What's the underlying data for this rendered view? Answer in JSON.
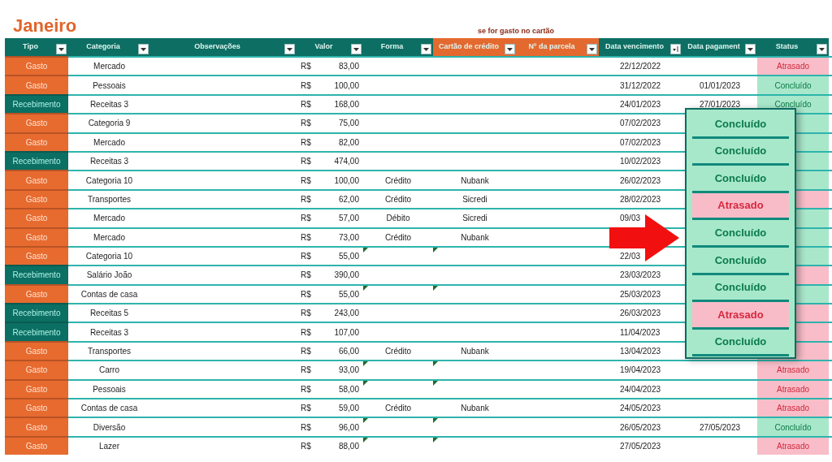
{
  "title": "Janeiro",
  "note": "se for gasto no cartão",
  "columns": [
    {
      "label": "Tipo",
      "kind": "main",
      "sorted": false
    },
    {
      "label": "Categoria",
      "kind": "main",
      "sorted": false
    },
    {
      "label": "Observações",
      "kind": "main",
      "sorted": false
    },
    {
      "label": "Valor",
      "kind": "main",
      "sorted": false
    },
    {
      "label": "Forma",
      "kind": "main",
      "sorted": false
    },
    {
      "label": "Cartão de crédito",
      "kind": "card",
      "sorted": false
    },
    {
      "label": "Nº da parcela",
      "kind": "card",
      "sorted": false
    },
    {
      "label": "Data vencimento",
      "kind": "main",
      "sorted": true
    },
    {
      "label": "Data pagament",
      "kind": "main",
      "sorted": false
    },
    {
      "label": "Status",
      "kind": "main",
      "sorted": false
    }
  ],
  "rows": [
    {
      "tipo": "Gasto",
      "kind": "gasto",
      "categoria": "Mercado",
      "currency": "R$",
      "valor": "83,00",
      "vencimento": "22/12/2022",
      "status": "Atrasado",
      "overdue": true,
      "flag": false
    },
    {
      "tipo": "Gasto",
      "kind": "gasto",
      "categoria": "Pessoais",
      "currency": "R$",
      "valor": "100,00",
      "vencimento": "31/12/2022",
      "pagamento": "01/01/2023",
      "status": "Concluído",
      "overdue": false,
      "flag": false
    },
    {
      "tipo": "Recebimento",
      "kind": "recebimento",
      "categoria": "Receitas 3",
      "currency": "R$",
      "valor": "168,00",
      "vencimento": "24/01/2023",
      "pagamento": "27/01/2023",
      "status": "Concluído",
      "overdue": false,
      "flag": false
    },
    {
      "tipo": "Gasto",
      "kind": "gasto",
      "categoria": "Categoria 9",
      "currency": "R$",
      "valor": "75,00",
      "vencimento": "07/02/2023",
      "overdue": false,
      "flag": false
    },
    {
      "tipo": "Gasto",
      "kind": "gasto",
      "categoria": "Mercado",
      "currency": "R$",
      "valor": "82,00",
      "vencimento": "07/02/2023",
      "overdue": false,
      "flag": false
    },
    {
      "tipo": "Recebimento",
      "kind": "recebimento",
      "categoria": "Receitas 3",
      "currency": "R$",
      "valor": "474,00",
      "vencimento": "10/02/2023",
      "overdue": false,
      "flag": false
    },
    {
      "tipo": "Gasto",
      "kind": "gasto",
      "categoria": "Categoria 10",
      "currency": "R$",
      "valor": "100,00",
      "forma": "Crédito",
      "cartao": "Nubank",
      "vencimento": "26/02/2023",
      "overdue": false,
      "flag": false
    },
    {
      "tipo": "Gasto",
      "kind": "gasto",
      "categoria": "Transportes",
      "currency": "R$",
      "valor": "62,00",
      "forma": "Crédito",
      "cartao": "Sicredi",
      "vencimento": "28/02/2023",
      "overdue": true,
      "flag": false
    },
    {
      "tipo": "Gasto",
      "kind": "gasto",
      "categoria": "Mercado",
      "currency": "R$",
      "valor": "57,00",
      "forma": "Débito",
      "cartao": "Sicredi",
      "vencimento": "09/03",
      "overdue": false,
      "flag": false
    },
    {
      "tipo": "Gasto",
      "kind": "gasto",
      "categoria": "Mercado",
      "currency": "R$",
      "valor": "73,00",
      "forma": "Crédito",
      "cartao": "Nubank",
      "overdue": false,
      "flag": false
    },
    {
      "tipo": "Gasto",
      "kind": "gasto",
      "categoria": "Categoria 10",
      "currency": "R$",
      "valor": "55,00",
      "vencimento": "22/03",
      "overdue": false,
      "flag": true
    },
    {
      "tipo": "Recebimento",
      "kind": "recebimento",
      "categoria": "Salário João",
      "currency": "R$",
      "valor": "390,00",
      "vencimento": "23/03/2023",
      "overdue": true,
      "flag": false
    },
    {
      "tipo": "Gasto",
      "kind": "gasto",
      "categoria": "Contas de casa",
      "currency": "R$",
      "valor": "55,00",
      "vencimento": "25/03/2023",
      "overdue": false,
      "flag": true
    },
    {
      "tipo": "Recebimento",
      "kind": "recebimento",
      "categoria": "Receitas 5",
      "currency": "R$",
      "valor": "243,00",
      "vencimento": "26/03/2023",
      "overdue": true,
      "flag": false
    },
    {
      "tipo": "Recebimento",
      "kind": "recebimento",
      "categoria": "Receitas 3",
      "currency": "R$",
      "valor": "107,00",
      "vencimento": "11/04/2023",
      "overdue": true,
      "flag": false
    },
    {
      "tipo": "Gasto",
      "kind": "gasto",
      "categoria": "Transportes",
      "currency": "R$",
      "valor": "66,00",
      "forma": "Crédito",
      "cartao": "Nubank",
      "vencimento": "13/04/2023",
      "overdue": true,
      "flag": false
    },
    {
      "tipo": "Gasto",
      "kind": "gasto",
      "categoria": "Carro",
      "currency": "R$",
      "valor": "93,00",
      "vencimento": "19/04/2023",
      "status": "Atrasado",
      "overdue": true,
      "flag": true
    },
    {
      "tipo": "Gasto",
      "kind": "gasto",
      "categoria": "Pessoais",
      "currency": "R$",
      "valor": "58,00",
      "vencimento": "24/04/2023",
      "status": "Atrasado",
      "overdue": true,
      "flag": true
    },
    {
      "tipo": "Gasto",
      "kind": "gasto",
      "categoria": "Contas de casa",
      "currency": "R$",
      "valor": "59,00",
      "forma": "Crédito",
      "cartao": "Nubank",
      "vencimento": "24/05/2023",
      "status": "Atrasado",
      "overdue": true,
      "flag": false
    },
    {
      "tipo": "Gasto",
      "kind": "gasto",
      "categoria": "Diversão",
      "currency": "R$",
      "valor": "96,00",
      "vencimento": "26/05/2023",
      "pagamento": "27/05/2023",
      "status": "Concluído",
      "overdue": false,
      "flag": true
    },
    {
      "tipo": "Gasto",
      "kind": "gasto",
      "categoria": "Lazer",
      "currency": "R$",
      "valor": "88,00",
      "vencimento": "27/05/2023",
      "status": "Atrasado",
      "overdue": true,
      "flag": true
    }
  ],
  "status_popup": [
    {
      "label": "Concluído",
      "overdue": false
    },
    {
      "label": "Concluído",
      "overdue": false
    },
    {
      "label": "Concluído",
      "overdue": false
    },
    {
      "label": "Atrasado",
      "overdue": true
    },
    {
      "label": "Concluído",
      "overdue": false
    },
    {
      "label": "Concluído",
      "overdue": false
    },
    {
      "label": "Concluído",
      "overdue": false
    },
    {
      "label": "Atrasado",
      "overdue": true
    },
    {
      "label": "Concluído",
      "overdue": false
    }
  ]
}
